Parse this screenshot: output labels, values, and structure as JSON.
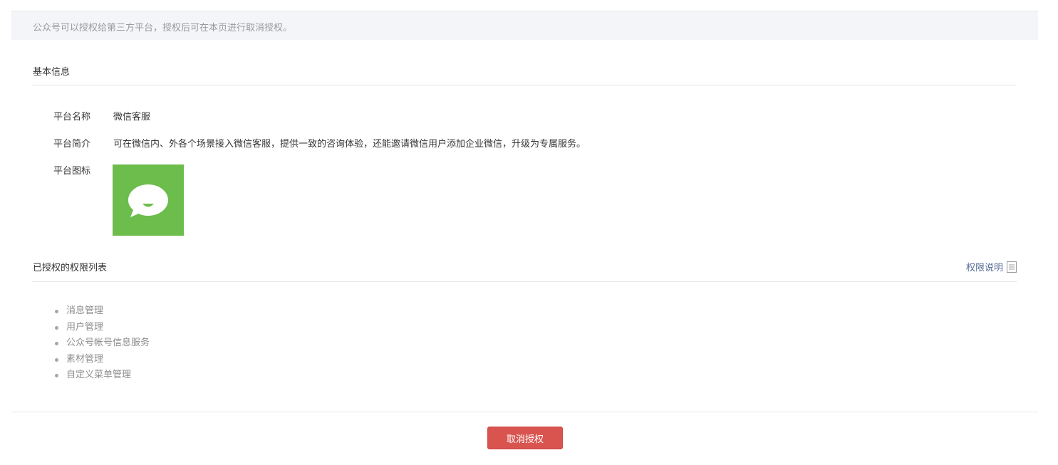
{
  "notice": {
    "text": "公众号可以授权给第三方平台，授权后可在本页进行取消授权。"
  },
  "basic_info": {
    "title": "基本信息",
    "rows": [
      {
        "label": "平台名称",
        "value": "微信客服"
      },
      {
        "label": "平台简介",
        "value": "可在微信内、外各个场景接入微信客服，提供一致的咨询体验，还能邀请微信用户添加企业微信，升级为专属服务。"
      },
      {
        "label": "平台图标",
        "icon": "wechat-customer-service-chat-bubble-icon"
      }
    ]
  },
  "permissions": {
    "title": "已授权的权限列表",
    "help_link_label": "权限说明",
    "help_icon": "document-icon",
    "items": [
      "消息管理",
      "用户管理",
      "公众号帐号信息服务",
      "素材管理",
      "自定义菜单管理"
    ]
  },
  "footer": {
    "cancel_button_label": "取消授权"
  },
  "colors": {
    "icon_green": "#6cbd4b",
    "danger_button": "#d9534f",
    "link": "#576b95",
    "notice_bg": "#f4f5f9"
  }
}
